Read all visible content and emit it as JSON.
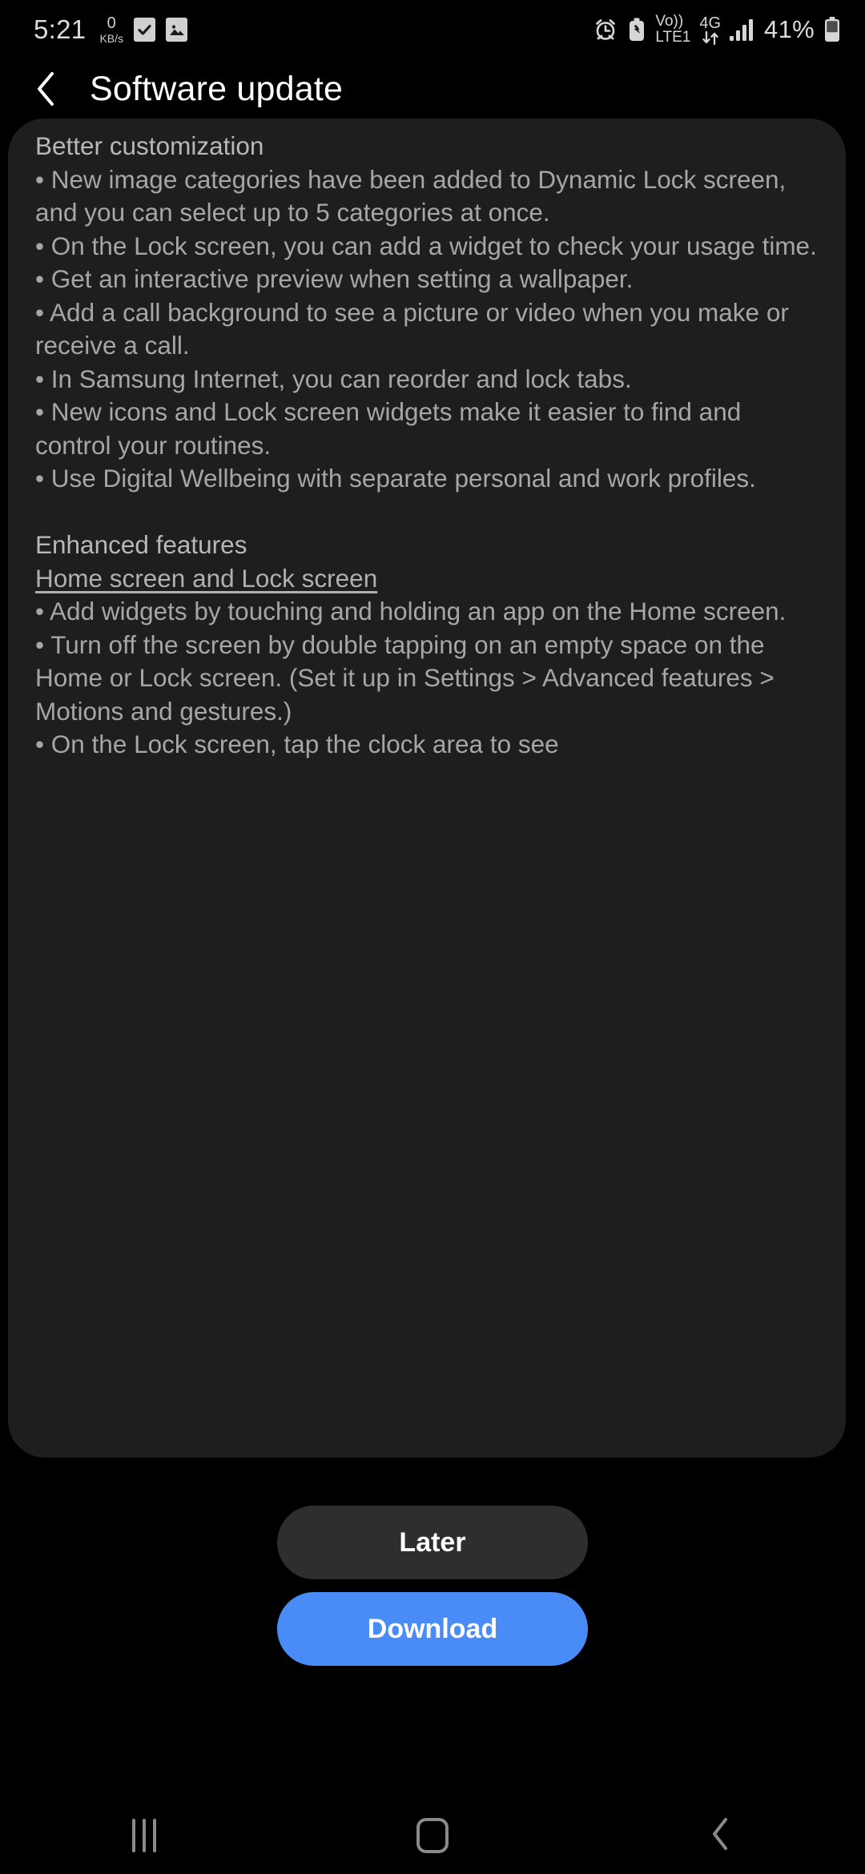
{
  "status_bar": {
    "time": "5:21",
    "network_speed_value": "0",
    "network_speed_unit": "KB/s",
    "icons_left": [
      "checkbox-checked-icon",
      "image-icon"
    ],
    "icons_right": [
      "alarm-icon",
      "battery-saver-icon",
      "signal-bars-icon",
      "battery-icon"
    ],
    "volte_line1": "Vo))",
    "volte_line2": "LTE1",
    "network_type": "4G",
    "data_arrows": "down-up-arrows-icon",
    "battery_percent": "41%"
  },
  "header": {
    "back_icon": "back-chevron-icon",
    "title": "Software update"
  },
  "release_notes": {
    "section1_heading": "Better customization",
    "section1_items": [
      "• New image categories have been added to Dynamic Lock screen, and you can select up to 5 categories at once.",
      "• On the Lock screen, you can add a widget to check your usage time.",
      "• Get an interactive preview when setting a wallpaper.",
      "• Add a call background to see a picture or video when you make or receive a call.",
      "• In Samsung Internet, you can reorder and lock tabs.",
      "• New icons and Lock screen widgets make it easier to find and control your routines.",
      "• Use Digital Wellbeing with separate personal and work profiles."
    ],
    "section2_heading": "Enhanced features",
    "section2_subheading": "Home screen and Lock screen",
    "section2_items": [
      "• Add widgets by touching and holding an app on the Home screen.",
      "• Turn off the screen by double tapping on an empty space on the Home or Lock screen. (Set it up in Settings > Advanced features > Motions and gestures.)",
      "• On the Lock screen, tap the clock area to see"
    ]
  },
  "actions": {
    "later_label": "Later",
    "download_label": "Download",
    "download_color": "#4a8cf7",
    "later_color": "#2e2e2e"
  },
  "nav_bar": {
    "recents_icon": "recents-icon",
    "home_icon": "home-icon",
    "back_icon": "back-icon"
  }
}
